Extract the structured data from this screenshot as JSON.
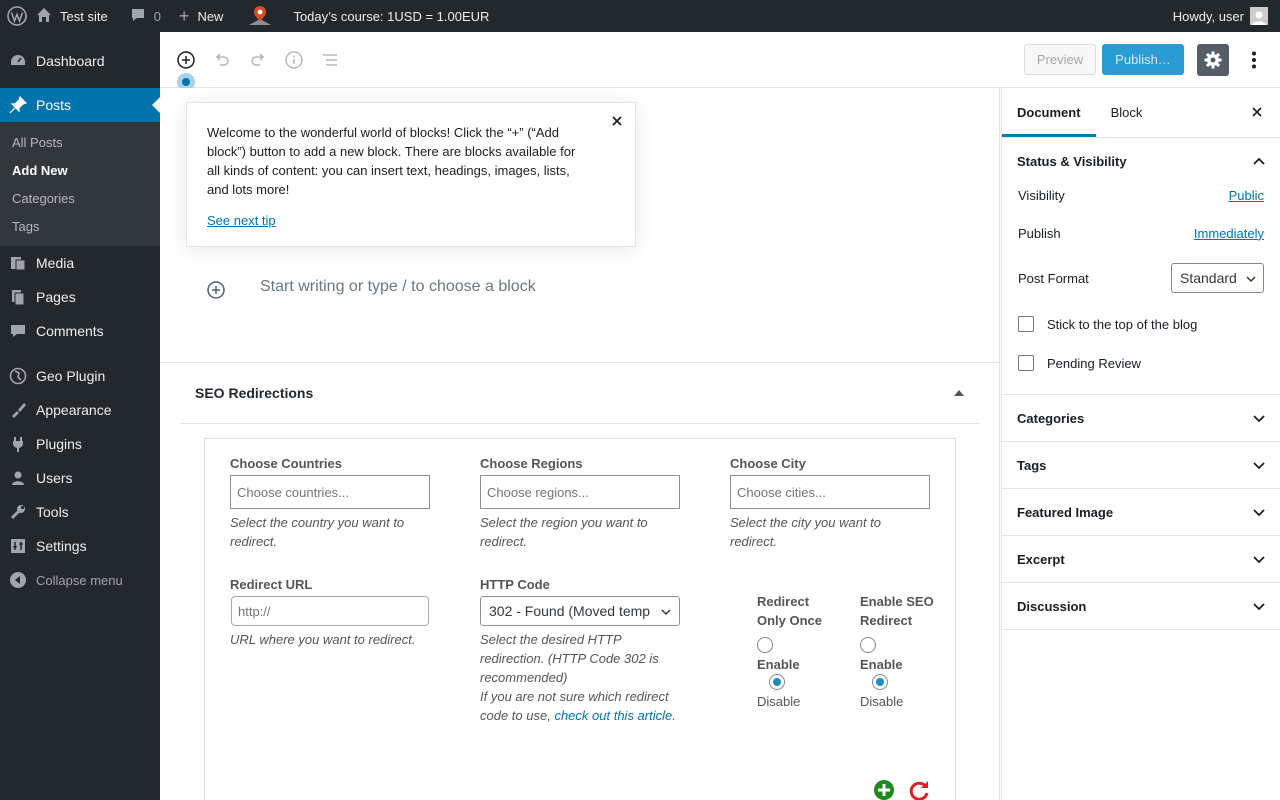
{
  "adminbar": {
    "site_name": "Test site",
    "comments_count": "0",
    "new_label": "New",
    "course_text": "Today’s course: 1USD = 1.00EUR",
    "howdy": "Howdy, user"
  },
  "sidebar": {
    "items": [
      {
        "label": "Dashboard",
        "icon": "dashboard-icon"
      },
      {
        "label": "Posts",
        "icon": "pin-icon"
      },
      {
        "label": "Media",
        "icon": "media-icon"
      },
      {
        "label": "Pages",
        "icon": "pages-icon"
      },
      {
        "label": "Comments",
        "icon": "comments-icon"
      },
      {
        "label": "Geo Plugin",
        "icon": "geo-plugin-icon"
      },
      {
        "label": "Appearance",
        "icon": "appearance-icon"
      },
      {
        "label": "Plugins",
        "icon": "plugins-icon"
      },
      {
        "label": "Users",
        "icon": "users-icon"
      },
      {
        "label": "Tools",
        "icon": "tools-icon"
      },
      {
        "label": "Settings",
        "icon": "settings-icon"
      }
    ],
    "posts_sub": [
      "All Posts",
      "Add New",
      "Categories",
      "Tags"
    ],
    "collapse": "Collapse menu"
  },
  "header": {
    "preview": "Preview",
    "publish": "Publish…"
  },
  "tip": {
    "text": "Welcome to the wonderful world of blocks! Click the “+” (“Add block”) button to add a new block. There are blocks available for all kinds of content: you can insert text, headings, images, lists, and lots more!",
    "link": "See next tip"
  },
  "editor": {
    "placeholder": "Start writing or type / to choose a block"
  },
  "seo": {
    "title": "SEO Redirections",
    "countries_label": "Choose Countries",
    "countries_placeholder": "Choose countries...",
    "countries_desc": "Select the country you want to redirect.",
    "regions_label": "Choose Regions",
    "regions_placeholder": "Choose regions...",
    "regions_desc": "Select the region you want to redirect.",
    "city_label": "Choose City",
    "city_placeholder": "Choose cities...",
    "city_desc": "Select the city you want to redirect.",
    "url_label": "Redirect URL",
    "url_placeholder": "http://",
    "url_desc": "URL where you want to redirect.",
    "http_label": "HTTP Code",
    "http_value": "302 - Found (Moved temp",
    "http_desc1": "Select the desired HTTP redirection. (HTTP Code 302 is recommended)",
    "http_desc2": "If you are not sure which redirect code to use, ",
    "http_link": "check out this article",
    "http_desc_end": ".",
    "once_label": "Redirect Only Once",
    "seo_label": "Enable SEO Redirect",
    "enable": "Enable",
    "disable": "Disable"
  },
  "panel": {
    "tab_document": "Document",
    "tab_block": "Block",
    "status_title": "Status & Visibility",
    "visibility_label": "Visibility",
    "visibility_value": "Public",
    "publish_label": "Publish",
    "publish_value": "Immediately",
    "format_label": "Post Format",
    "format_value": "Standard",
    "stick_label": "Stick to the top of the blog",
    "pending_label": "Pending Review",
    "sections": [
      "Categories",
      "Tags",
      "Featured Image",
      "Excerpt",
      "Discussion"
    ]
  },
  "colors": {
    "adminbar_bg": "#23282d",
    "active_blue": "#0073aa",
    "publish_blue": "#2b9bd3",
    "add_green": "#1e8a1e",
    "reset_red": "#e02020"
  }
}
